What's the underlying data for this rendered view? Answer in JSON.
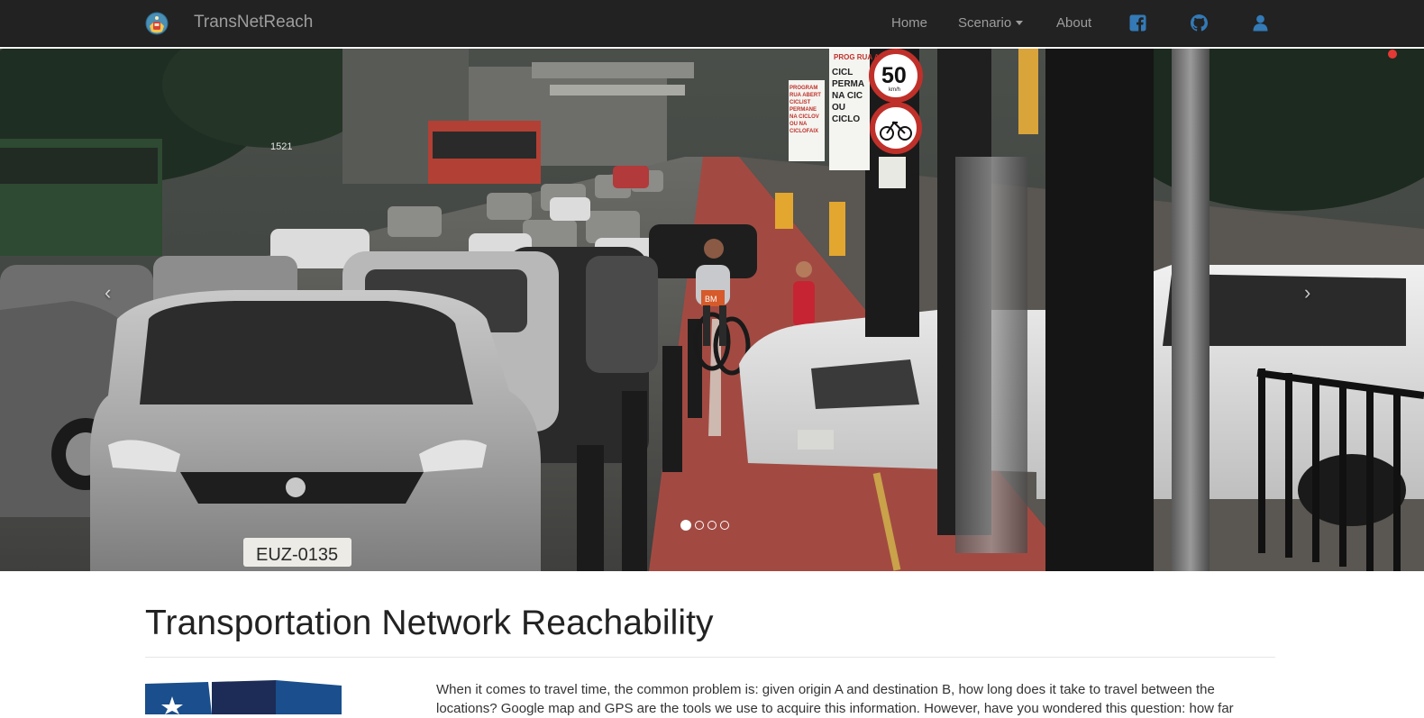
{
  "navbar": {
    "brand": "TransNetReach",
    "links": {
      "home": "Home",
      "scenario": "Scenario",
      "about": "About"
    },
    "icons": [
      "facebook-icon",
      "github-icon",
      "user-icon"
    ],
    "background": "#222222",
    "text_color": "#9d9d9d",
    "icon_color": "#337ab7"
  },
  "carousel": {
    "prev_label": "‹",
    "next_label": "›",
    "slide_count": 4,
    "active_slide": 1,
    "sign_speed": "50",
    "sign_speed_unit": "km/h",
    "sign_banner_title": "PROG RUA A",
    "sign_banner_text": "CICL PERMA NA CIC OU CICLO",
    "sign_small_text": "PROGRAM RUA ABERT CICLIST PERMANE NA CICLOV OU NA CICLOFAIX",
    "bus_display": "1521",
    "plate_text": "EUZ-0135",
    "bike_crate_text": "BM"
  },
  "content": {
    "title": "Transportation Network Reachability",
    "intro": "When it comes to travel time, the common problem is: given origin A and destination B, how long does it take to travel between the locations? Google map and GPS are the tools we use to acquire this information. However, have you wondered this question: how far"
  }
}
